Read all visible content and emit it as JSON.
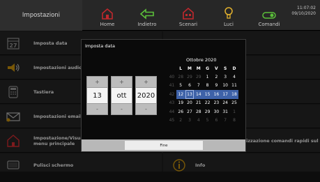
{
  "topbar": {
    "title": "Impostazioni",
    "nav": [
      {
        "label": "Home",
        "icon": "home-icon"
      },
      {
        "label": "Indietro",
        "icon": "back-arrow-icon"
      },
      {
        "label": "Scenari",
        "icon": "scenarios-icon"
      },
      {
        "label": "Luci",
        "icon": "lightbulb-icon"
      },
      {
        "label": "Comandi",
        "icon": "toggle-icon"
      }
    ],
    "time": "11:07:02",
    "date": "09/10/2020"
  },
  "menu": {
    "left": [
      {
        "label": "Imposta data",
        "icon": "calendar-icon"
      },
      {
        "label": "Impostazioni audio",
        "icon": "speaker-icon"
      },
      {
        "label": "Tastiera",
        "icon": "keypad-icon"
      },
      {
        "label": "Impostazioni email e",
        "icon": "envelope-icon"
      },
      {
        "label": "Impostazione/Visua menu principale",
        "icon": "home-icon"
      },
      {
        "label": "Pulisci schermo",
        "icon": "screen-icon"
      }
    ],
    "right_visible": [
      {
        "label": "izzazione comandi rapidi sul",
        "row": 4
      },
      {
        "label": "Info",
        "row": 5,
        "icon": "info-icon"
      }
    ]
  },
  "dialog": {
    "title": "Imposta data",
    "day": "13",
    "month": "ott",
    "year": "2020",
    "plus": "+",
    "minus": "-",
    "calendar": {
      "month_label": "Ottobre 2020",
      "weekday_headers": [
        "L",
        "M",
        "M",
        "G",
        "V",
        "S",
        "D"
      ],
      "weeks": [
        {
          "num": "40",
          "days": [
            [
              "28",
              "o"
            ],
            [
              "29",
              "o"
            ],
            [
              "29",
              "o"
            ],
            [
              "1",
              ""
            ],
            [
              "2",
              ""
            ],
            [
              "3",
              ""
            ],
            [
              "4",
              ""
            ]
          ]
        },
        {
          "num": "41",
          "days": [
            [
              "5",
              ""
            ],
            [
              "6",
              ""
            ],
            [
              "7",
              ""
            ],
            [
              "8",
              ""
            ],
            [
              "9",
              ""
            ],
            [
              "10",
              ""
            ],
            [
              "11",
              ""
            ]
          ]
        },
        {
          "num": "42",
          "days": [
            [
              "12",
              "s"
            ],
            [
              "13",
              "t"
            ],
            [
              "14",
              "s"
            ],
            [
              "15",
              "s"
            ],
            [
              "16",
              "s"
            ],
            [
              "17",
              "s"
            ],
            [
              "18",
              "s"
            ]
          ]
        },
        {
          "num": "43",
          "days": [
            [
              "19",
              ""
            ],
            [
              "20",
              ""
            ],
            [
              "21",
              ""
            ],
            [
              "22",
              ""
            ],
            [
              "23",
              ""
            ],
            [
              "24",
              ""
            ],
            [
              "25",
              ""
            ]
          ]
        },
        {
          "num": "44",
          "days": [
            [
              "26",
              ""
            ],
            [
              "27",
              ""
            ],
            [
              "28",
              ""
            ],
            [
              "29",
              ""
            ],
            [
              "30",
              ""
            ],
            [
              "31",
              ""
            ],
            [
              "1",
              "o"
            ]
          ]
        },
        {
          "num": "45",
          "days": [
            [
              "2",
              "o"
            ],
            [
              "3",
              "o"
            ],
            [
              "4",
              "o"
            ],
            [
              "5",
              "o"
            ],
            [
              "6",
              "o"
            ],
            [
              "7",
              "o"
            ],
            [
              "8",
              "o"
            ]
          ]
        }
      ]
    },
    "done_label": "Fine"
  },
  "colors": {
    "accent_red": "#c0282d",
    "accent_green": "#5bbf3a",
    "accent_yellow": "#e2b12d",
    "selection_blue": "#3e62a8"
  }
}
